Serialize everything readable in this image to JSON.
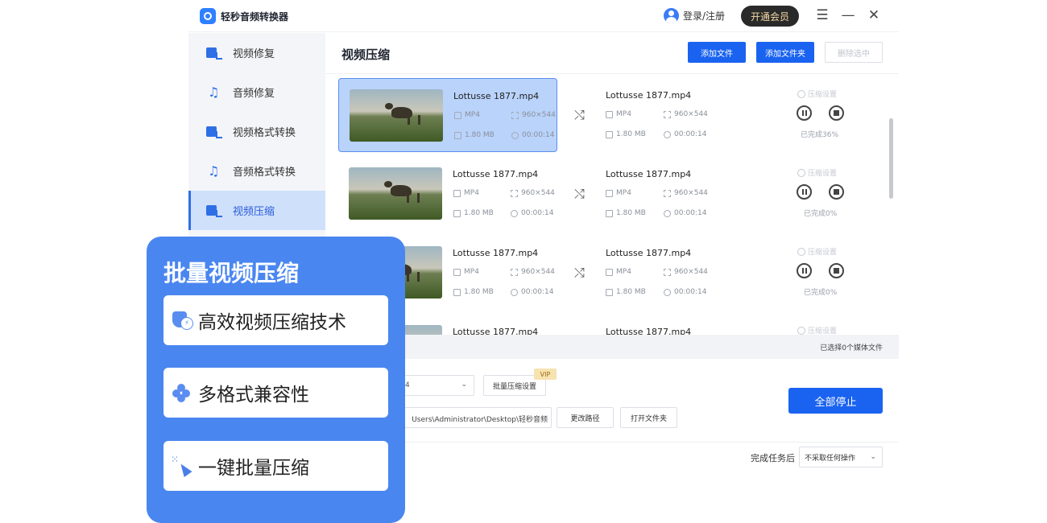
{
  "app": {
    "title": "轻秒音频转换器",
    "login": "登录/注册",
    "vip_button": "开通会员",
    "menu_icon": "☰",
    "minimize_icon": "—",
    "close_icon": "✕"
  },
  "sidebar": {
    "items": [
      {
        "label": "视频修复",
        "icon": "video-repair-icon"
      },
      {
        "label": "音频修复",
        "icon": "audio-repair-icon"
      },
      {
        "label": "视频格式转换",
        "icon": "video-convert-icon"
      },
      {
        "label": "音频格式转换",
        "icon": "audio-convert-icon"
      },
      {
        "label": "视频压缩",
        "icon": "video-compress-icon",
        "active": true
      }
    ]
  },
  "main": {
    "title": "视频压缩",
    "add_file": "添加文件",
    "add_folder": "添加文件夹",
    "remove_selected": "删除选中",
    "files": [
      {
        "name": "Lottusse 1877.mp4",
        "format": "MP4",
        "resolution": "960×544",
        "size": "1.80 MB",
        "duration": "00:00:14",
        "out_name": "Lottusse 1877.mp4",
        "out_format": "MP4",
        "out_resolution": "960×544",
        "out_size": "1.80 MB",
        "out_duration": "00:00:14",
        "setting": "压缩设置",
        "progress": "已完成36%"
      },
      {
        "name": "Lottusse 1877.mp4",
        "format": "MP4",
        "resolution": "960×544",
        "size": "1.80 MB",
        "duration": "00:00:14",
        "out_name": "Lottusse 1877.mp4",
        "out_format": "MP4",
        "out_resolution": "960×544",
        "out_size": "1.80 MB",
        "out_duration": "00:00:14",
        "setting": "压缩设置",
        "progress": "已完成0%"
      },
      {
        "name": "Lottusse 1877.mp4",
        "format": "MP4",
        "resolution": "960×544",
        "size": "1.80 MB",
        "duration": "00:00:14",
        "out_name": "Lottusse 1877.mp4",
        "out_format": "MP4",
        "out_resolution": "960×544",
        "out_size": "1.80 MB",
        "out_duration": "00:00:14",
        "setting": "压缩设置",
        "progress": "已完成0%"
      },
      {
        "name": "Lottusse 1877.mp4",
        "out_name": "Lottusse 1877.mp4",
        "setting": "压缩设置"
      }
    ],
    "status": "已选择0个媒体文件",
    "format_select_value": "4",
    "batch_setting": "批量压缩设置",
    "vip_tag": "VIP",
    "output_path": "Users\\Administrator\\Desktop\\轻秒音频",
    "change_path": "更改路径",
    "open_folder": "打开文件夹",
    "stop_all": "全部停止",
    "after_task_label": "完成任务后",
    "after_task_value": "不采取任何操作"
  },
  "promo": {
    "title": "批量视频压缩",
    "features": [
      {
        "label": "高效视频压缩技术",
        "icon": "shield-bolt-icon"
      },
      {
        "label": "多格式兼容性",
        "icon": "clover-icon"
      },
      {
        "label": "一键批量压缩",
        "icon": "cursor-click-icon"
      }
    ]
  },
  "colors": {
    "accent": "#1a63f0",
    "promo_bg": "#4a86f0",
    "sidebar_active": "#cfe0fb"
  }
}
